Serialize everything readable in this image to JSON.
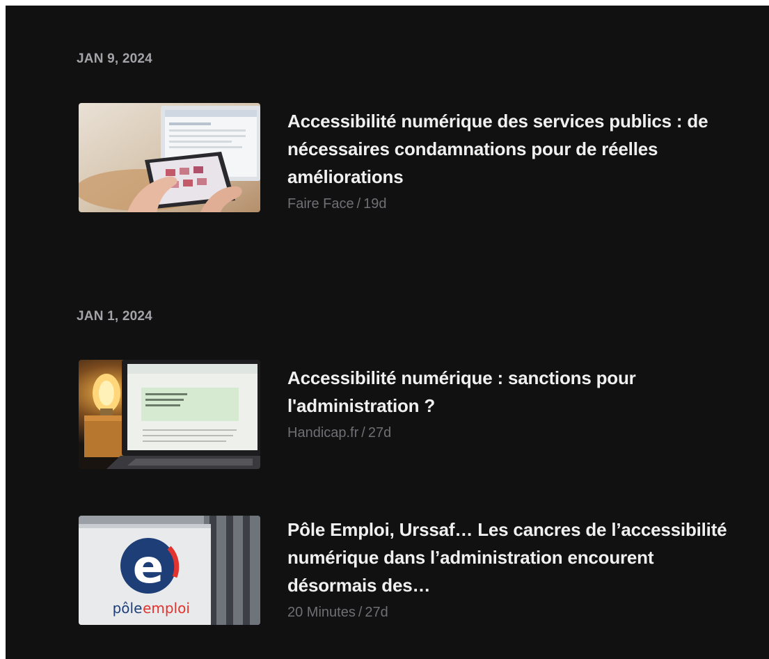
{
  "groups": [
    {
      "date": "JAN 9, 2024",
      "articles": [
        {
          "title": "Accessibilité numérique des services publics : de nécessaires condamnations pour de réelles améliorations",
          "source": "Faire Face",
          "age": "19d",
          "thumbnail_icon": "tablet-photo"
        }
      ]
    },
    {
      "date": "JAN 1, 2024",
      "articles": [
        {
          "title": "Accessibilité numérique : sanctions pour l'administration ?",
          "source": "Handicap.fr",
          "age": "27d",
          "thumbnail_icon": "laptop-lamp-photo"
        },
        {
          "title": "Pôle Emploi, Urssaf… Les cancres de l’accessibilité numérique dans l’administration encourent désormais des…",
          "source": "20 Minutes",
          "age": "27d",
          "thumbnail_icon": "pole-emploi-sign-photo",
          "thumbnail_text": "pôle emploi"
        }
      ]
    }
  ],
  "colors": {
    "background": "#111112",
    "date": "#a3a3a8",
    "title": "#f0f0f0",
    "meta": "#6f6f74"
  }
}
